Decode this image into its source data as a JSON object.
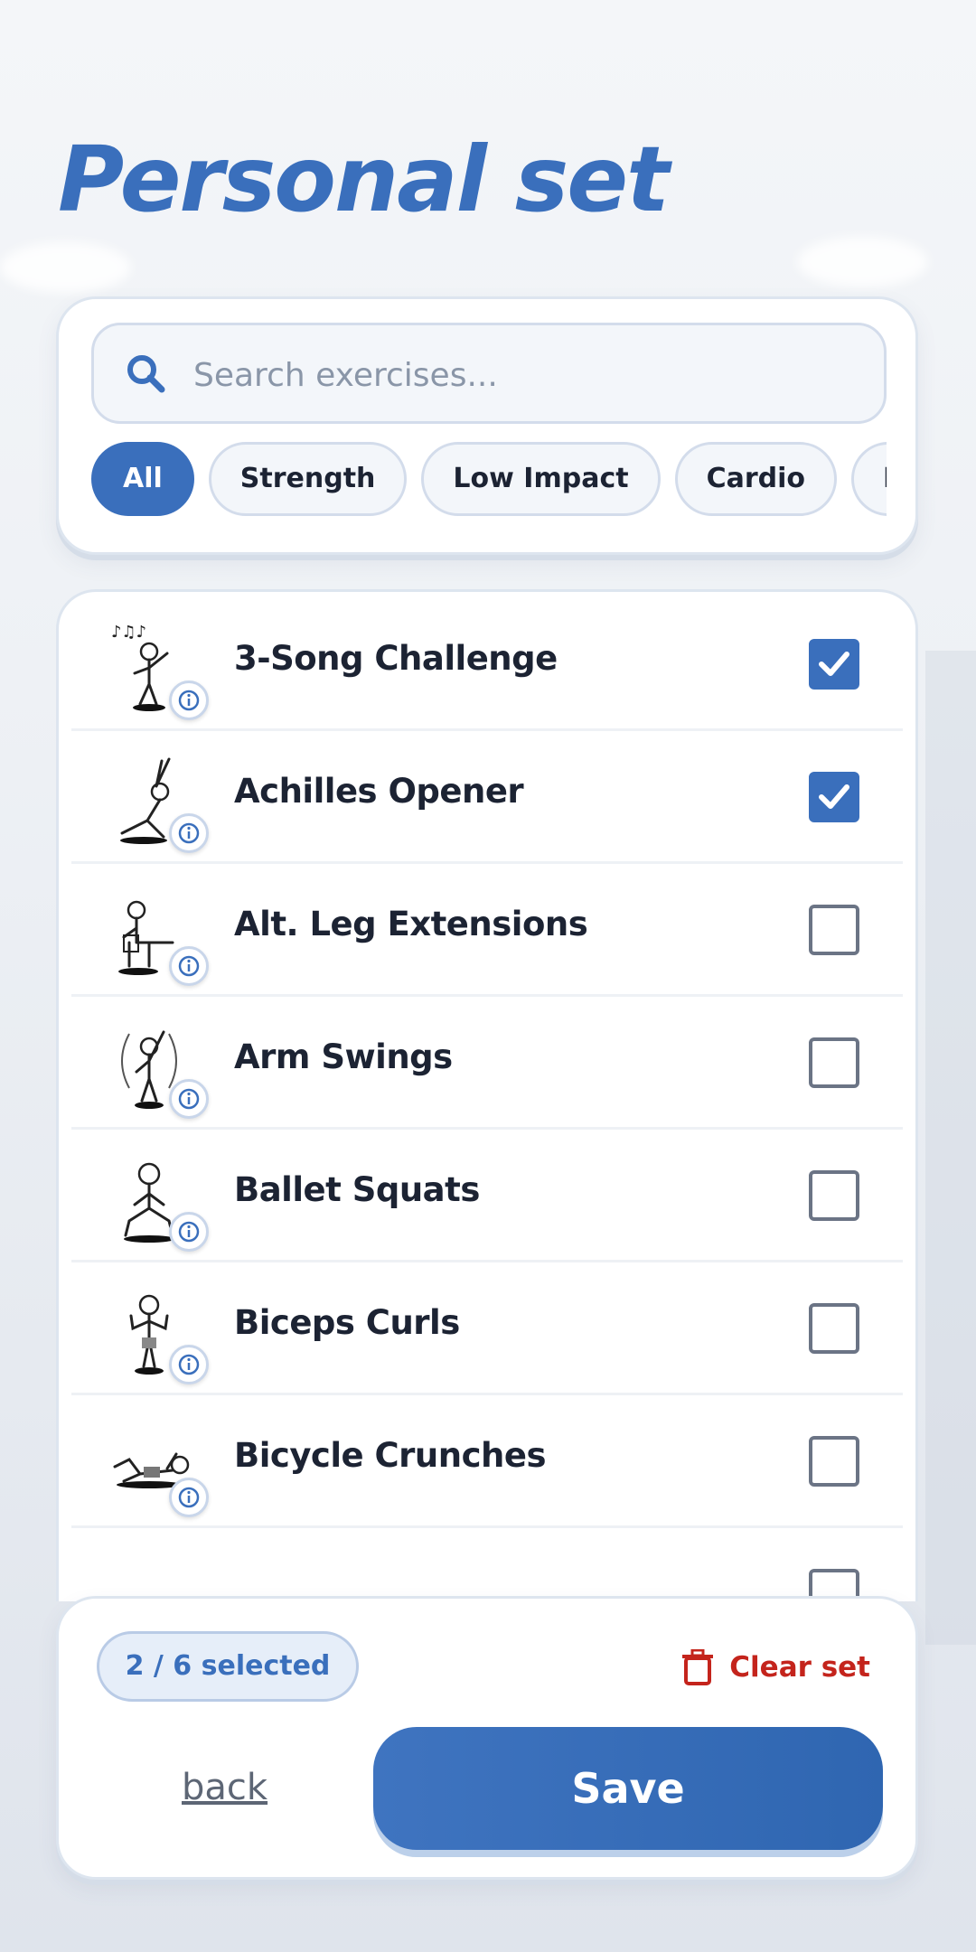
{
  "header": {
    "title": "Personal set"
  },
  "search": {
    "placeholder": "Search exercises..."
  },
  "filters": [
    {
      "label": "All",
      "active": true
    },
    {
      "label": "Strength",
      "active": false
    },
    {
      "label": "Low Impact",
      "active": false
    },
    {
      "label": "Cardio",
      "active": false
    },
    {
      "label": "Fl",
      "active": false
    }
  ],
  "exercises": [
    {
      "name": "3-Song Challenge",
      "checked": true
    },
    {
      "name": "Achilles Opener",
      "checked": true
    },
    {
      "name": "Alt. Leg Extensions",
      "checked": false
    },
    {
      "name": "Arm Swings",
      "checked": false
    },
    {
      "name": "Ballet Squats",
      "checked": false
    },
    {
      "name": "Biceps Curls",
      "checked": false
    },
    {
      "name": "Bicycle Crunches",
      "checked": false
    }
  ],
  "footer": {
    "selected_count": "2 / 6 selected",
    "clear_label": "Clear set",
    "back_label": "back",
    "save_label": "Save"
  },
  "colors": {
    "accent": "#3a6fbc",
    "danger": "#c4241c",
    "text": "#1c2333"
  },
  "icons": {
    "search": "search-icon",
    "info": "info-icon",
    "check": "checkmark-icon",
    "trash": "trash-icon"
  }
}
